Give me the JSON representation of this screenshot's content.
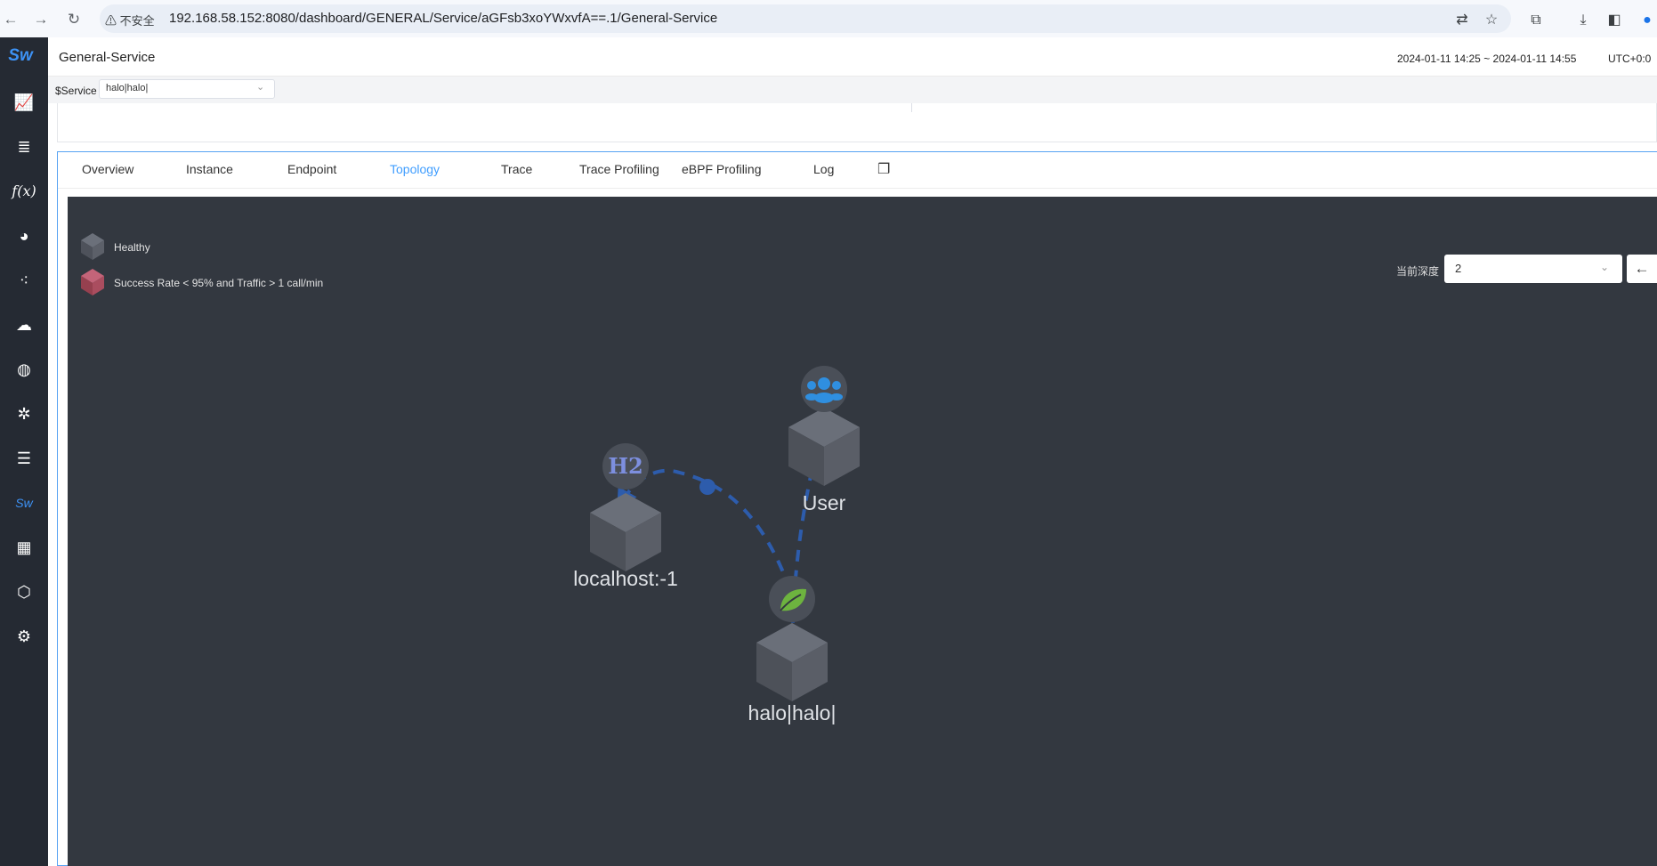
{
  "browser": {
    "insecure_label": "不安全",
    "url": "192.168.58.152:8080/dashboard/GENERAL/Service/aGFsb3xoYWxvfA==.1/General-Service"
  },
  "header": {
    "title": "General-Service",
    "time_range": "2024-01-11 14:25 ~ 2024-01-11 14:55",
    "timezone": "UTC+0:0"
  },
  "filter": {
    "service_label": "$Service",
    "service_value": "halo|halo|"
  },
  "tabs": [
    {
      "label": "Overview"
    },
    {
      "label": "Instance"
    },
    {
      "label": "Endpoint"
    },
    {
      "label": "Topology",
      "active": true
    },
    {
      "label": "Trace"
    },
    {
      "label": "Trace Profiling"
    },
    {
      "label": "eBPF Profiling"
    },
    {
      "label": "Log"
    }
  ],
  "topology": {
    "legend": [
      {
        "label": "Healthy",
        "color": "#5a5f69"
      },
      {
        "label": "Success Rate < 95% and Traffic > 1 call/min",
        "color": "#b04a60"
      }
    ],
    "depth_label": "当前深度",
    "depth_value": "2",
    "nodes": [
      {
        "name": "User",
        "icon": "users-icon"
      },
      {
        "name": "localhost:-1",
        "icon": "h2-database-icon",
        "icon_text": "H2"
      },
      {
        "name": "halo|halo|",
        "icon": "spring-leaf-icon"
      }
    ],
    "colors": {
      "background": "#333840",
      "edge": "#2d5cac",
      "accent": "#409eff"
    }
  }
}
